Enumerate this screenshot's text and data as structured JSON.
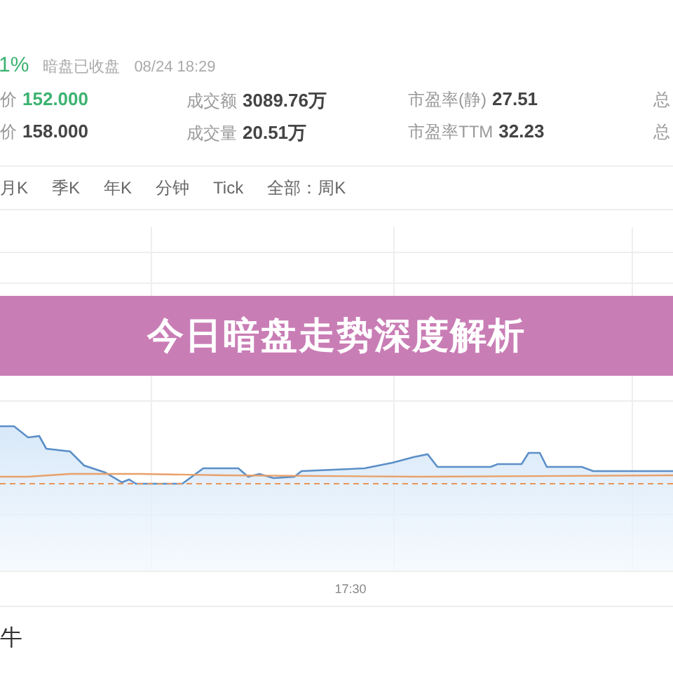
{
  "quote": {
    "change": "1%",
    "status": "暗盘已收盘",
    "time": "08/24 18:29"
  },
  "stats": [
    [
      {
        "label": "价",
        "value": "152.000",
        "kind": "up"
      },
      {
        "label": "成交额",
        "value": "3089.76万",
        "kind": "plain"
      },
      {
        "label": "市盈率(静)",
        "value": "27.51",
        "kind": "plain"
      },
      {
        "label": "总"
      }
    ],
    [
      {
        "label": "价",
        "value": "158.000",
        "kind": "plain"
      },
      {
        "label": "成交量",
        "value": "20.51万",
        "kind": "plain"
      },
      {
        "label": "市盈率TTM",
        "value": "32.23",
        "kind": "plain"
      },
      {
        "label": "总"
      }
    ]
  ],
  "period_tabs": [
    "月K",
    "季K",
    "年K",
    "分钟",
    "Tick",
    "全部：周K"
  ],
  "chart": {
    "time_axis": [
      "17:30"
    ]
  },
  "banner": {
    "title": "今日暗盘走势深度解析"
  },
  "section_title": "牛"
}
